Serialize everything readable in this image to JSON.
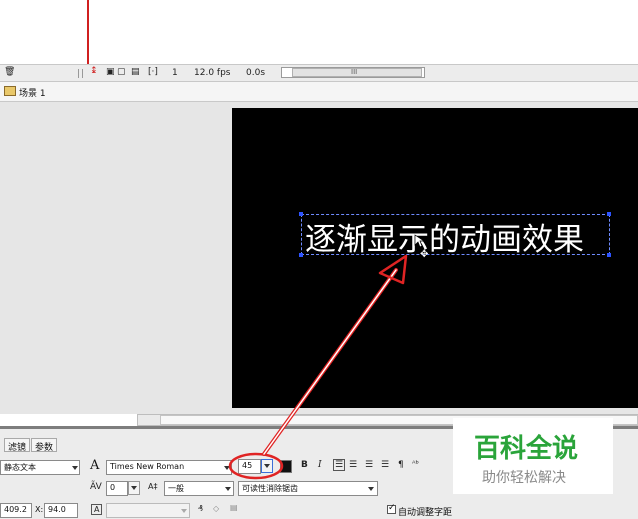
{
  "timeline": {
    "frame": "1",
    "fps": "12.0 fps",
    "time": "0.0s",
    "thumb_grip": "III"
  },
  "scene": {
    "label": "场景 1"
  },
  "stage": {
    "text": "逐渐显示的动画效果"
  },
  "properties": {
    "tabs": [
      "滤镜",
      "参数"
    ],
    "text_type": "静态文本",
    "font_name": "Times New Roman",
    "font_size": "45",
    "letter_spacing": "0",
    "baseline": "一般",
    "anti_alias": "可读性消除锯齿",
    "width_value": "409.2",
    "x_label": "X:",
    "x_value": "94.0",
    "auto_kern": "自动调整字距"
  },
  "watermark": {
    "title": "百科全说",
    "subtitle": "助你轻松解决"
  },
  "colors": {
    "stage": "#000000",
    "selection": "#2e54ff",
    "annotation": "#e02424",
    "brand_green": "#2aa43a"
  }
}
